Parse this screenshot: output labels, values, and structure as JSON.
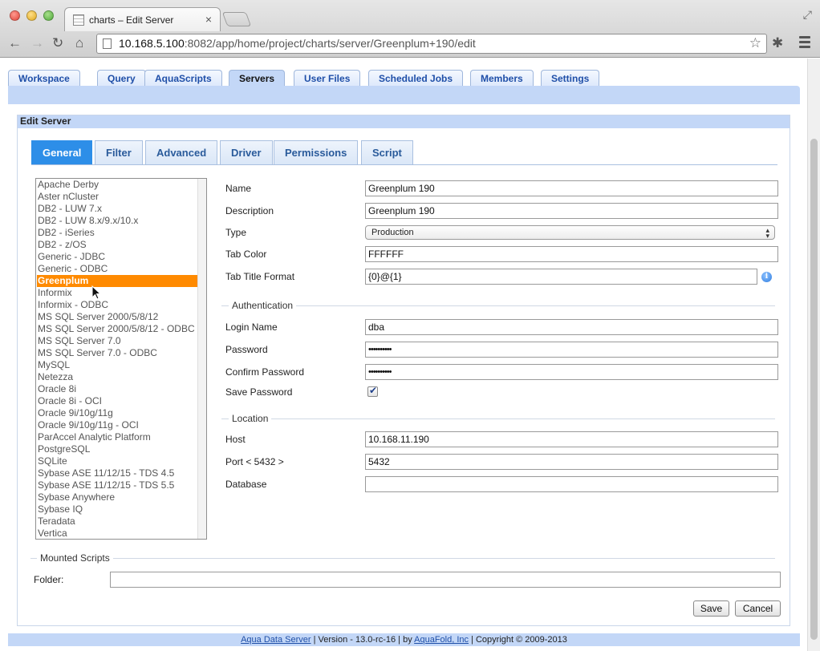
{
  "browser": {
    "tab_title": "charts – Edit Server",
    "url_host": "10.168.5.100",
    "url_rest": ":8082/app/home/project/charts/server/Greenplum+190/edit"
  },
  "app_tabs": [
    "Workspace",
    "Query",
    "AquaScripts",
    "Servers",
    "User Files",
    "Scheduled Jobs",
    "Members",
    "Settings"
  ],
  "panel_title": "Edit Server",
  "sub_tabs": [
    "General",
    "Filter",
    "Advanced",
    "Driver",
    "Permissions",
    "Script"
  ],
  "drivers": [
    "Apache Derby",
    "Aster nCluster",
    "DB2 - LUW 7.x",
    "DB2 - LUW 8.x/9.x/10.x",
    "DB2 - iSeries",
    "DB2 - z/OS",
    "Generic - JDBC",
    "Generic - ODBC",
    "Greenplum",
    "Informix",
    "Informix - ODBC",
    "MS SQL Server 2000/5/8/12",
    "MS SQL Server 2000/5/8/12 - ODBC",
    "MS SQL Server 7.0",
    "MS SQL Server 7.0 - ODBC",
    "MySQL",
    "Netezza",
    "Oracle 8i",
    "Oracle 8i - OCI",
    "Oracle 9i/10g/11g",
    "Oracle 9i/10g/11g - OCI",
    "ParAccel Analytic Platform",
    "PostgreSQL",
    "SQLite",
    "Sybase ASE 11/12/15 - TDS 4.5",
    "Sybase ASE 11/12/15 - TDS 5.5",
    "Sybase Anywhere",
    "Sybase IQ",
    "Teradata",
    "Vertica"
  ],
  "selected_driver": "Greenplum",
  "form": {
    "name_label": "Name",
    "name_value": "Greenplum 190",
    "description_label": "Description",
    "description_value": "Greenplum 190",
    "type_label": "Type",
    "type_value": "Production",
    "tab_color_label": "Tab Color",
    "tab_color_value": "FFFFFF",
    "tab_title_format_label": "Tab Title Format",
    "tab_title_format_value": "{0}@{1}",
    "authentication_legend": "Authentication",
    "login_name_label": "Login Name",
    "login_name_value": "dba",
    "password_label": "Password",
    "password_value": "••••••••••",
    "confirm_password_label": "Confirm Password",
    "confirm_password_value": "••••••••••",
    "save_password_label": "Save Password",
    "save_password_checked": true,
    "location_legend": "Location",
    "host_label": "Host",
    "host_value": "10.168.11.190",
    "port_label": "Port < 5432 >",
    "port_value": "5432",
    "database_label": "Database",
    "database_value": ""
  },
  "mounted": {
    "legend": "Mounted Scripts",
    "folder_label": "Folder:",
    "folder_value": ""
  },
  "buttons": {
    "save": "Save",
    "cancel": "Cancel"
  },
  "footer": {
    "product": "Aqua Data Server",
    "version": " | Version - 13.0-rc-16 | by ",
    "company": "AquaFold, Inc",
    "copyright": " | Copyright © 2009-2013"
  },
  "colors": {
    "accent": "#2d8ee8",
    "selection": "#ff8a00",
    "band": "#c3d7f7"
  }
}
